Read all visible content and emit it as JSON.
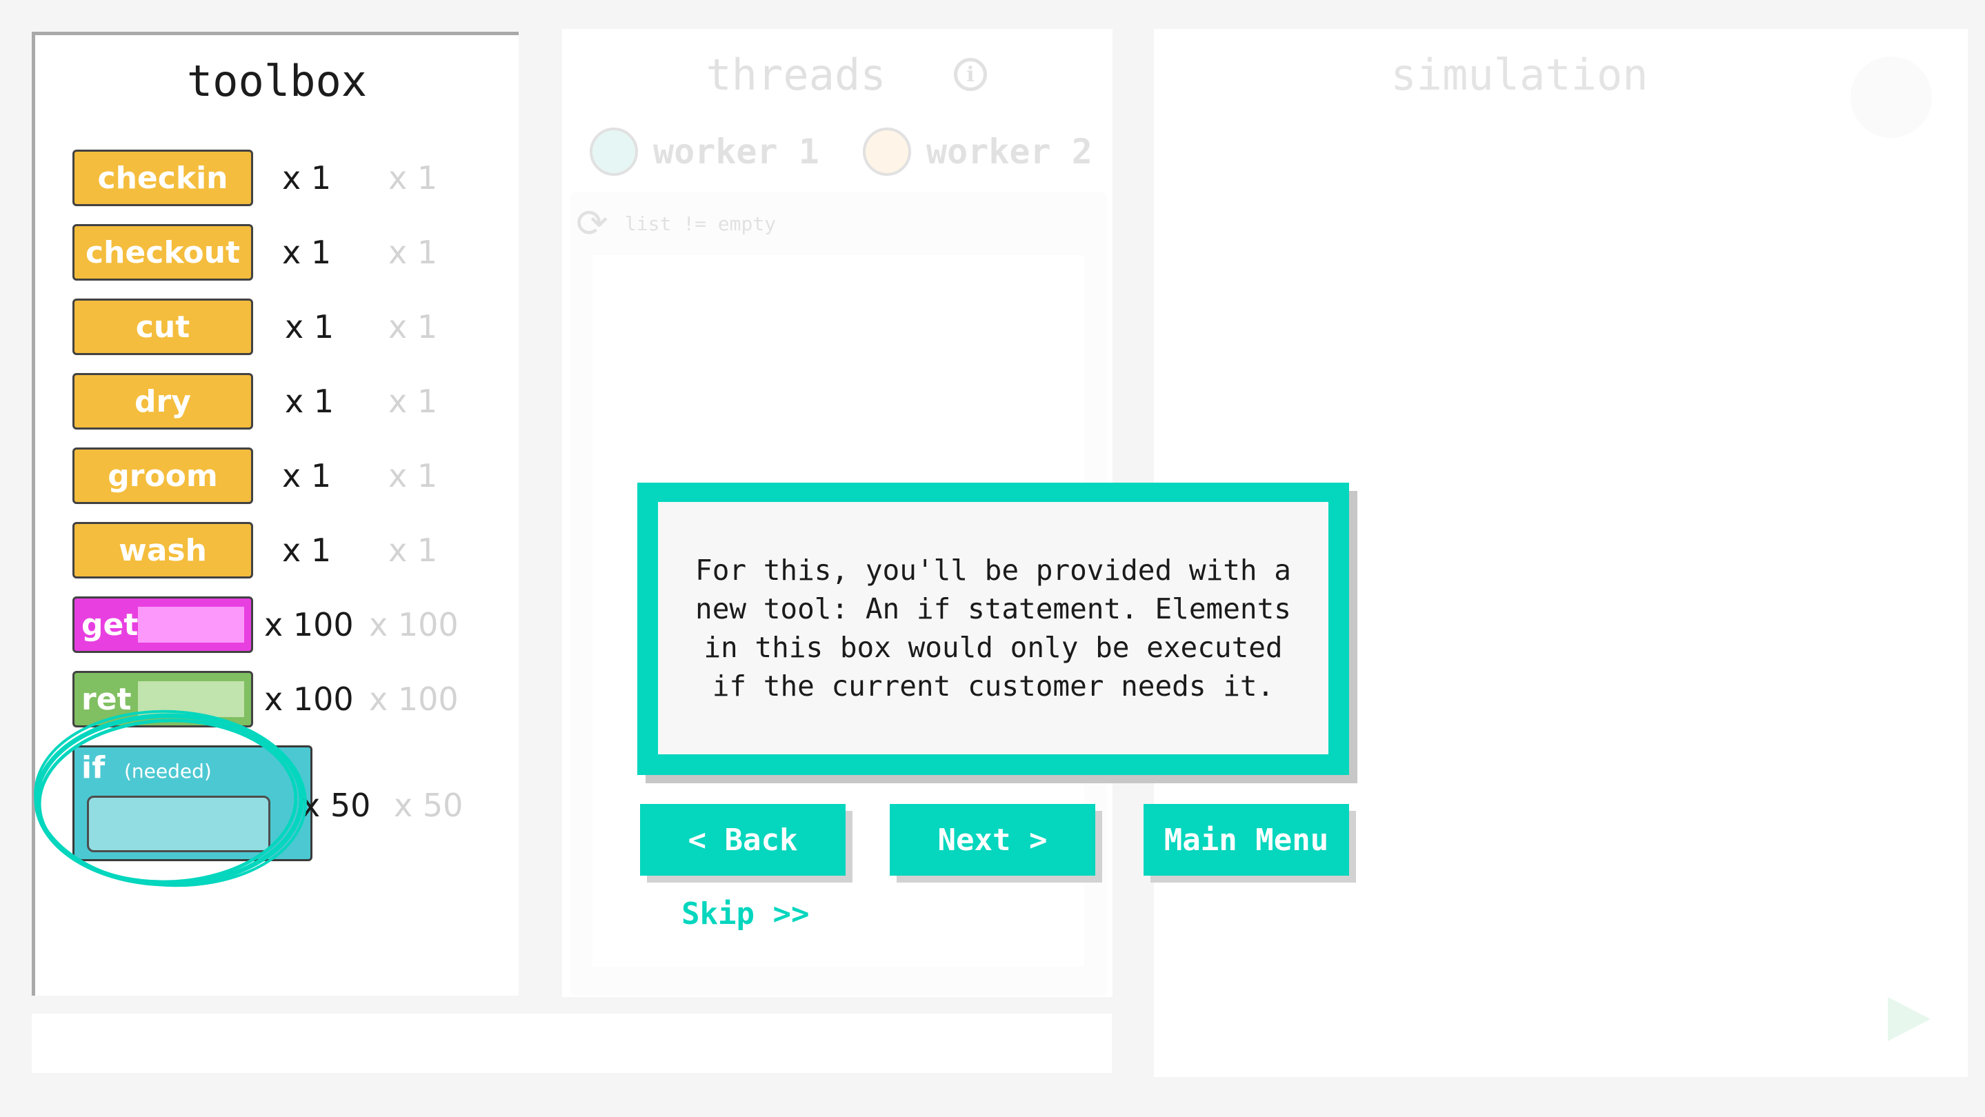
{
  "toolbox": {
    "title": "toolbox",
    "tools": [
      {
        "label": "checkin",
        "count": "x 1",
        "max": "x 1"
      },
      {
        "label": "checkout",
        "count": "x 1",
        "max": "x 1"
      },
      {
        "label": "cut",
        "count": "x 1",
        "max": "x 1"
      },
      {
        "label": "dry",
        "count": "x 1",
        "max": "x 1"
      },
      {
        "label": "groom",
        "count": "x 1",
        "max": "x 1"
      },
      {
        "label": "wash",
        "count": "x 1",
        "max": "x 1"
      },
      {
        "label": "get",
        "count": "x 100",
        "max": "x 100"
      },
      {
        "label": "ret",
        "count": "x 100",
        "max": "x 100"
      }
    ],
    "if_block": {
      "keyword": "if",
      "note": "(needed)",
      "count": "x 50",
      "max": "x 50"
    }
  },
  "threads": {
    "title": "threads",
    "info_icon": "i",
    "workers": [
      {
        "label": "worker 1",
        "avatar": "person-avatar-icon"
      },
      {
        "label": "worker 2",
        "avatar": "person-avatar-icon"
      }
    ],
    "loop_label": "list != empty"
  },
  "simulation": {
    "title": "simulation"
  },
  "dialog": {
    "text": "For this, you'll be provided with a new tool: An if statement. Elements in this box would only be executed if the current customer needs it.",
    "back_label": "< Back",
    "next_label": "Next >",
    "menu_label": "Main Menu",
    "skip_label": "Skip >>"
  },
  "colors": {
    "accent": "#05d6be",
    "tool_yellow": "#f4bd3d",
    "tool_magenta": "#e83fe1",
    "tool_green": "#80bf62",
    "if_teal": "#4cc8d2"
  }
}
